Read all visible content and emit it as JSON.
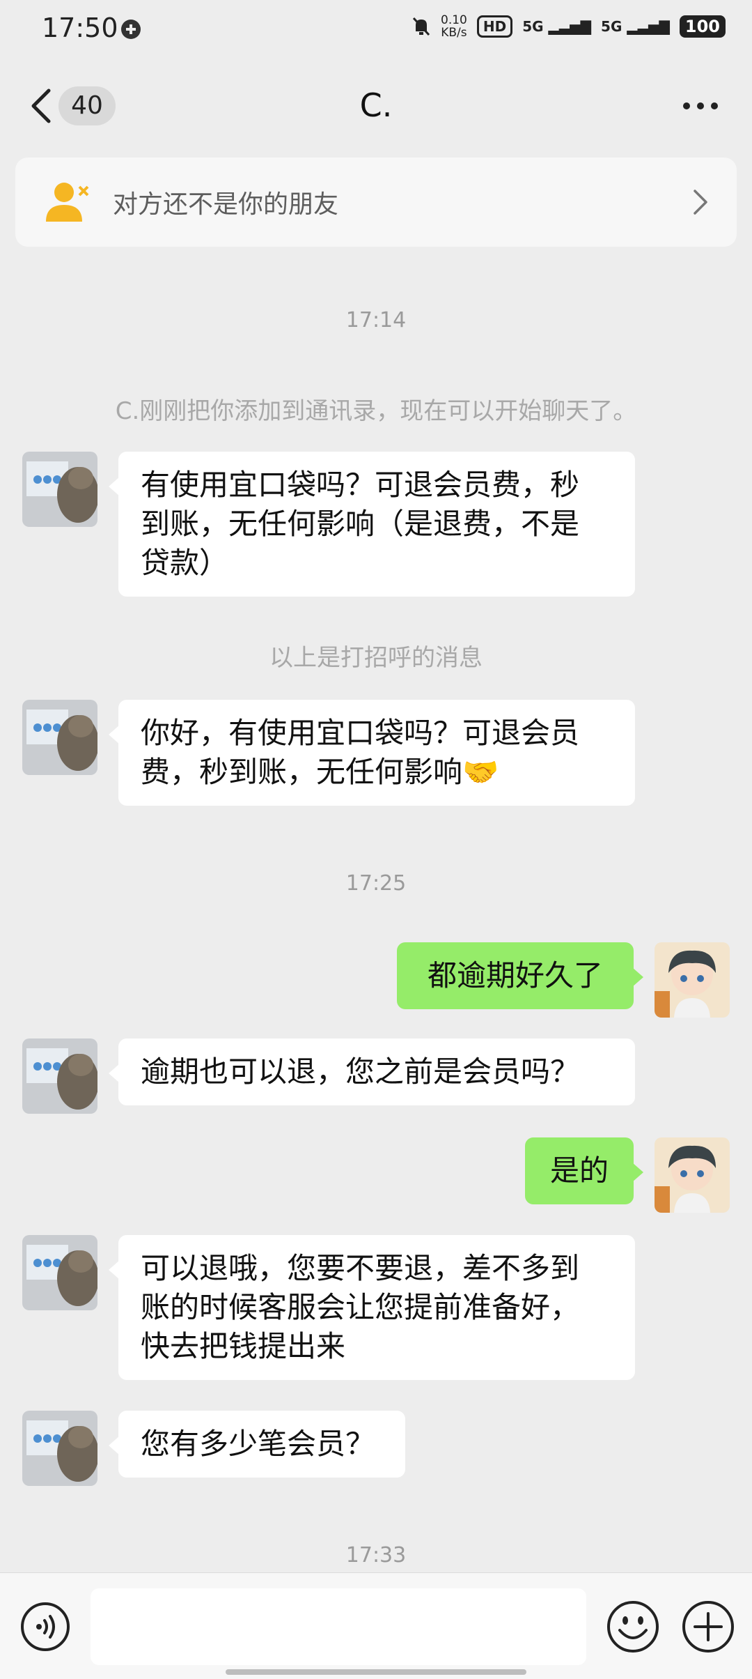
{
  "status_bar": {
    "time": "17:50",
    "speed_value": "0.10",
    "speed_unit": "KB/s",
    "hd_label": "HD",
    "net1": "5G",
    "net2": "5G",
    "battery": "100"
  },
  "nav": {
    "unread_count": "40",
    "title": "C."
  },
  "notice": {
    "text": "对方还不是你的朋友"
  },
  "chat": {
    "ts1": "17:14",
    "sys1": "C.刚刚把你添加到通讯录，现在可以开始聊天了。",
    "msg1": [
      "有使用宜口袋吗？可退会员费，秒",
      "到账，无任何影响（是退费，不是",
      "贷款）"
    ],
    "sys2": "以上是打招呼的消息",
    "msg2": [
      "你好，有使用宜口袋吗？可退会员",
      "费，秒到账，无任何影响🤝"
    ],
    "ts2": "17:25",
    "msg3": "都逾期好久了",
    "msg4": "逾期也可以退，您之前是会员吗？",
    "msg5": "是的",
    "msg6": [
      "可以退哦，您要不要退，差不多到",
      "账的时候客服会让您提前准备好，",
      "快去把钱提出来"
    ],
    "msg7": "您有多少笔会员？",
    "ts3": "17:33"
  },
  "colors": {
    "background": "#ededed",
    "bubble_self": "#95ec69",
    "bubble_other": "#ffffff",
    "notice_icon": "#f5b623"
  },
  "icons": {
    "back": "chevron-left-icon",
    "more": "more-dots-icon",
    "notice": "add-friend-icon",
    "voice": "voice-icon",
    "emoji": "emoji-icon",
    "plus": "plus-icon"
  }
}
